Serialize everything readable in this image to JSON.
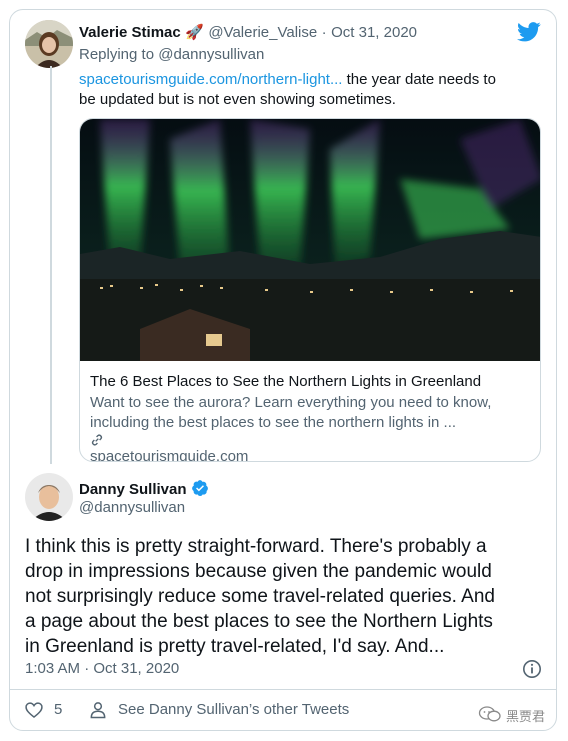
{
  "reply_tweet": {
    "author_name": "Valerie Stimac",
    "author_emoji": "🚀",
    "handle": "@Valerie_Valise",
    "separator": "·",
    "date": "Oct 31, 2020",
    "replying_prefix": "Replying to",
    "replying_handle": "@dannysullivan",
    "link_text": "spacetourismguide.com/northern-light...",
    "text_line1": " the year date needs to",
    "text_line2": "be updated but is not even showing sometimes."
  },
  "link_card": {
    "title": "The 6 Best Places to See the Northern Lights in Greenland",
    "desc_line1": "Want to see the aurora? Learn everything you need to know,",
    "desc_line2": "including the best places to see the northern lights in ...",
    "domain": "spacetourismguide.com"
  },
  "main_tweet": {
    "author_name": "Danny Sullivan",
    "handle": "@dannysullivan",
    "body_lines": [
      "I think this is pretty straight-forward. There's probably a",
      "drop in impressions because given the pandemic would",
      "not surprisingly reduce some travel-related queries. And",
      "a page about the best places to see the Northern Lights",
      "in Greenland is pretty travel-related, I'd say. And..."
    ],
    "timestamp": "1:03 AM · Oct 31, 2020"
  },
  "footer": {
    "like_count": "5",
    "other_tweets_label": "See Danny Sullivan’s other Tweets"
  },
  "watermark": "黑贾君",
  "colors": {
    "twitter_blue": "#1d9bf0",
    "link": "#1b95e0",
    "muted": "#536471",
    "border": "#cfd9de"
  },
  "icons": [
    "twitter-bird-icon",
    "verified-badge-icon",
    "info-icon",
    "heart-icon",
    "person-icon",
    "link-icon",
    "wechat-icon"
  ]
}
